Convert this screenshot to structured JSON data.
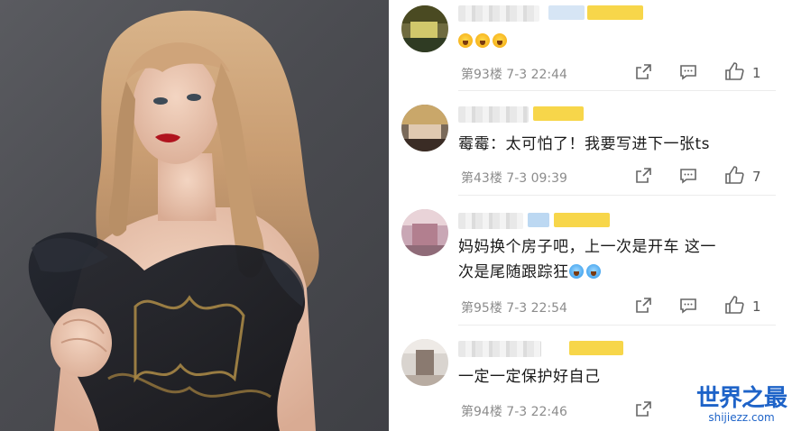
{
  "photo": {
    "description_icon": "portrait-photo"
  },
  "comments": [
    {
      "text": "😱😱😱",
      "floor": "第93楼",
      "time": "7-3 22:44",
      "likes": "1",
      "emoji_icons": [
        "shocked-emoji-icon",
        "shocked-emoji-icon",
        "shocked-emoji-icon"
      ]
    },
    {
      "text": "霉霉：太可怕了！我要写进下一张ts",
      "floor": "第43楼",
      "time": "7-3 09:39",
      "likes": "7"
    },
    {
      "text": "妈妈换个房子吧，上一次是开车 这一次是尾随跟踪狂",
      "line1": "妈妈换个房子吧，上一次是开车 这一",
      "line2": "次是尾随跟踪狂",
      "floor": "第95楼",
      "time": "7-3 22:54",
      "likes": "1"
    },
    {
      "text": "一定一定保护好自己",
      "floor": "第94楼",
      "time": "7-3 22:46",
      "likes": ""
    }
  ],
  "watermark": {
    "title": "世界之最",
    "url": "shijiezz.com"
  },
  "colors": {
    "accent": "#1e63c8",
    "meta": "#8c8c8c",
    "badge": "#f7d64a"
  }
}
